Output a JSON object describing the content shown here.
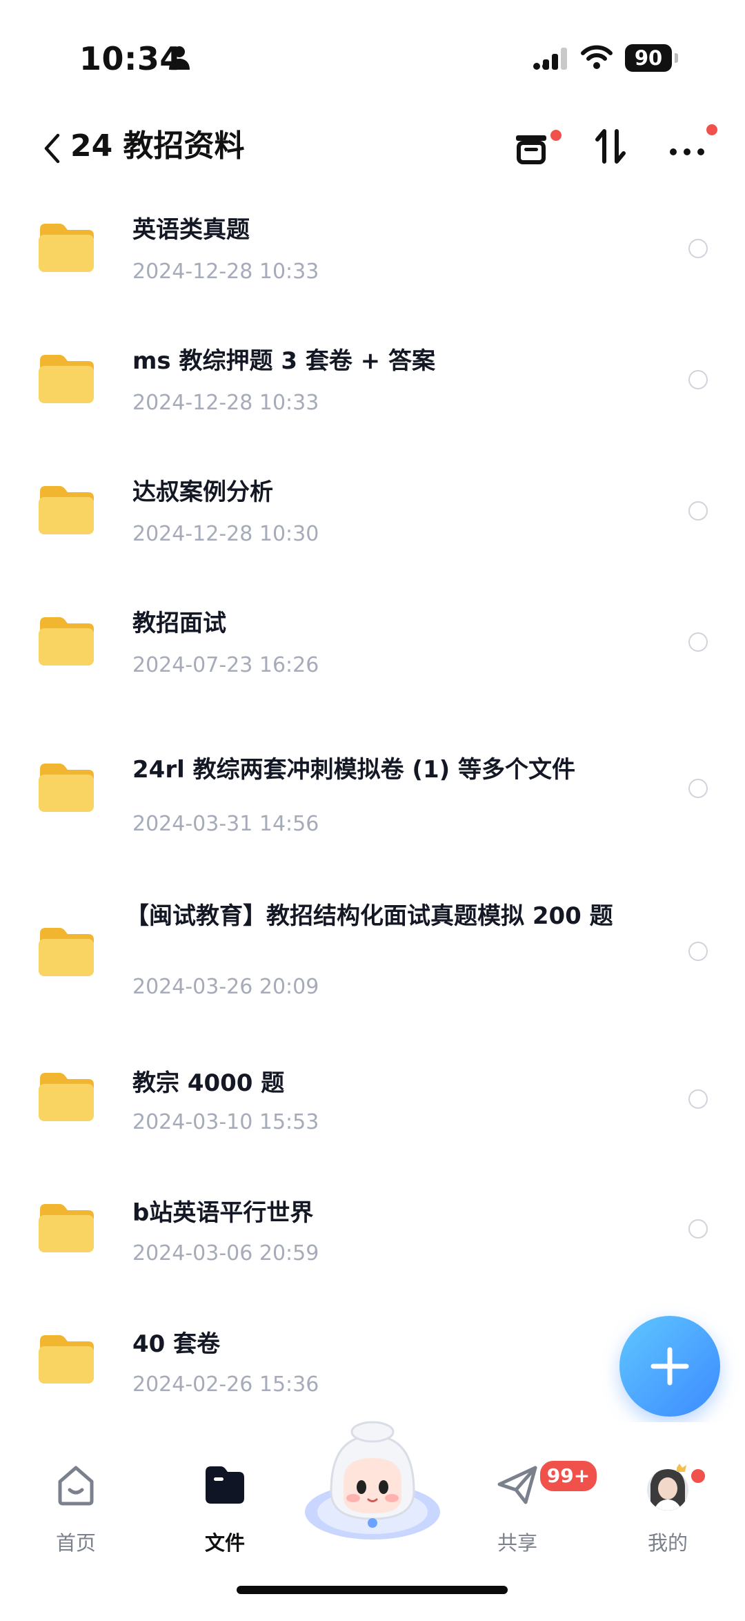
{
  "status_bar": {
    "time": "10:34",
    "battery": "90"
  },
  "header": {
    "title": "24 教招资料",
    "back_icon": "chevron-left-icon",
    "actions": [
      "archive-icon",
      "sort-icon",
      "more-icon"
    ]
  },
  "files": [
    {
      "name": "英语类真题",
      "date": "2024-12-28 10:33"
    },
    {
      "name": "ms 教综押题 3 套卷 + 答案",
      "date": "2024-12-28 10:33"
    },
    {
      "name": "达叔案例分析",
      "date": "2024-12-28 10:30"
    },
    {
      "name": "教招面试",
      "date": "2024-07-23 16:26"
    },
    {
      "name": "24rl 教综两套冲刺模拟卷 (1) 等多个文件",
      "date": "2024-03-31 14:56"
    },
    {
      "name": "【闽试教育】教招结构化面试真题模拟 200 题",
      "date": "2024-03-26 20:09"
    },
    {
      "name": "教宗 4000 题",
      "date": "2024-03-10 15:53"
    },
    {
      "name": "b站英语平行世界",
      "date": "2024-03-06 20:59"
    },
    {
      "name": "40 套卷",
      "date": "2024-02-26 15:36"
    }
  ],
  "fab_icon": "plus-icon",
  "nav": {
    "home": "首页",
    "files": "文件",
    "share": "共享",
    "share_badge": "99+",
    "mine": "我的"
  },
  "colors": {
    "accent": "#3d8bff",
    "badge": "#f0514a",
    "folder": "#f7c948"
  }
}
